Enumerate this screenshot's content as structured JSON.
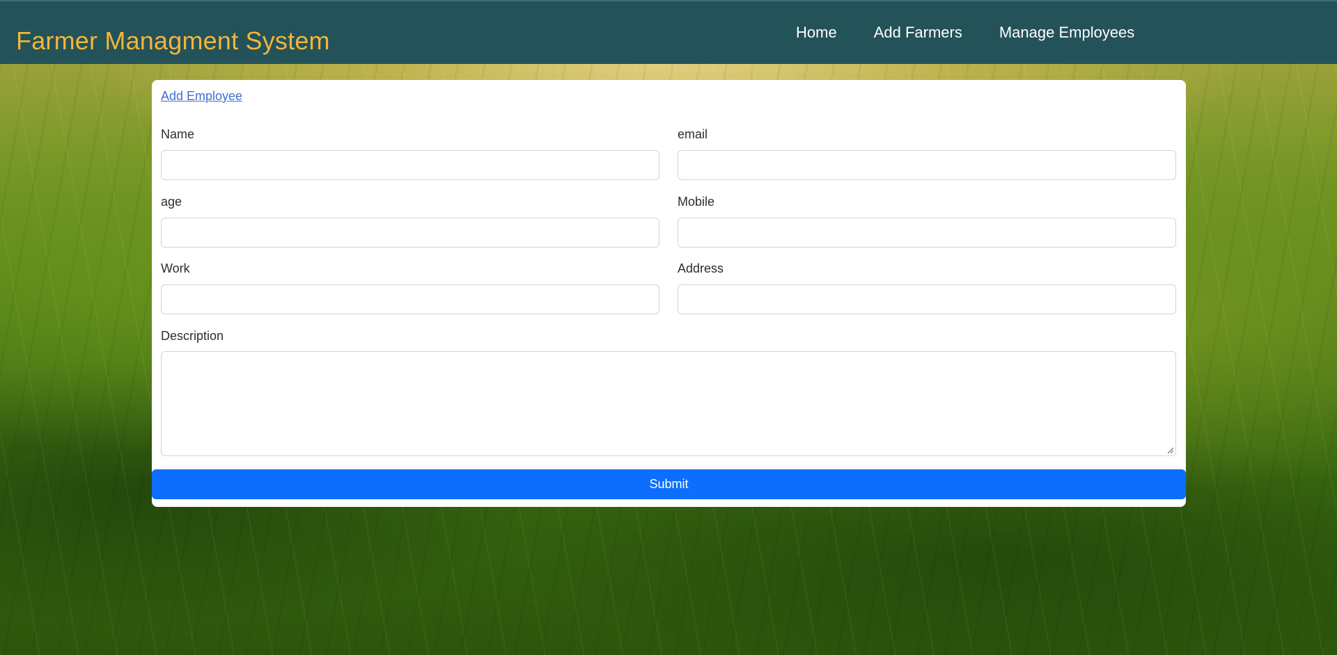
{
  "navbar": {
    "brand": "Farmer Managment System",
    "links": [
      {
        "label": "Home"
      },
      {
        "label": "Add Farmers"
      },
      {
        "label": "Manage Employees"
      }
    ]
  },
  "form": {
    "title": "Add Employee",
    "fields": {
      "name": {
        "label": "Name",
        "value": ""
      },
      "email": {
        "label": "email",
        "value": ""
      },
      "age": {
        "label": "age",
        "value": ""
      },
      "mobile": {
        "label": "Mobile",
        "value": ""
      },
      "work": {
        "label": "Work",
        "value": ""
      },
      "address": {
        "label": "Address",
        "value": ""
      },
      "description": {
        "label": "Description",
        "value": ""
      }
    },
    "submit_label": "Submit"
  },
  "colors": {
    "navbar_bg": "#235259",
    "brand": "#f3b53a",
    "primary": "#0d6efd",
    "link": "#3f6fd3"
  }
}
